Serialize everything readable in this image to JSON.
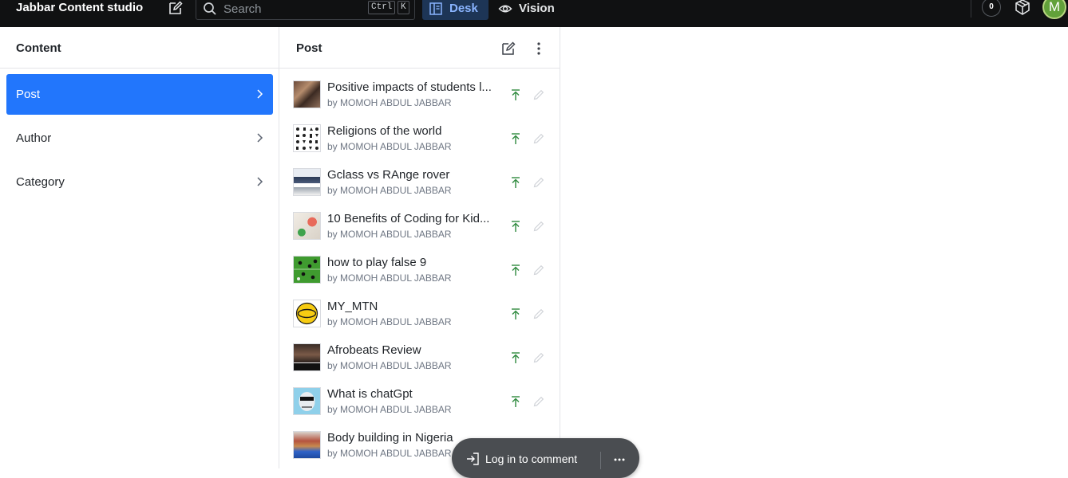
{
  "topbar": {
    "brand": "Jabbar Content studio",
    "search_placeholder": "Search",
    "shortcut_ctrl": "Ctrl",
    "shortcut_k": "K",
    "tools": {
      "desk": "Desk",
      "vision": "Vision"
    },
    "notification_count": "0",
    "avatar_initial": "M",
    "colors": {
      "bar": "#101112",
      "desk_active_bg": "#1d3556",
      "desk_active_text": "#8ab4ff",
      "avatar": "#62a13a"
    }
  },
  "content_pane": {
    "title": "Content",
    "items": [
      {
        "label": "Post",
        "active": true
      },
      {
        "label": "Author",
        "active": false
      },
      {
        "label": "Category",
        "active": false
      }
    ],
    "accent": "#2276fc"
  },
  "post_pane": {
    "title": "Post",
    "posts": [
      {
        "title": "Positive impacts of students l...",
        "author": "by MOMOH ABDUL JABBAR",
        "thumb_icon": "classroom-photo"
      },
      {
        "title": "Religions of the world",
        "author": "by MOMOH ABDUL JABBAR",
        "thumb_icon": "religious-symbols"
      },
      {
        "title": "Gclass vs RAnge rover",
        "author": "by MOMOH ABDUL JABBAR",
        "thumb_icon": "cars-photo"
      },
      {
        "title": "10 Benefits of Coding for Kid...",
        "author": "by MOMOH ABDUL JABBAR",
        "thumb_icon": "kids-coding-photo"
      },
      {
        "title": "how to play false 9",
        "author": "by MOMOH ABDUL JABBAR",
        "thumb_icon": "football-pitch"
      },
      {
        "title": "MY_MTN",
        "author": "by MOMOH ABDUL JABBAR",
        "thumb_icon": "mtn-logo"
      },
      {
        "title": "Afrobeats Review",
        "author": "by MOMOH ABDUL JABBAR",
        "thumb_icon": "afrobeats-photo"
      },
      {
        "title": "What is chatGpt",
        "author": "by MOMOH ABDUL JABBAR",
        "thumb_icon": "robot-illustration"
      },
      {
        "title": "Body building in Nigeria",
        "author": "by MOMOH ABDUL JABBAR",
        "thumb_icon": "athlete-photo"
      }
    ],
    "published_color": "#2f8a3e"
  },
  "comment_bar": {
    "login_label": "Log in to comment"
  }
}
